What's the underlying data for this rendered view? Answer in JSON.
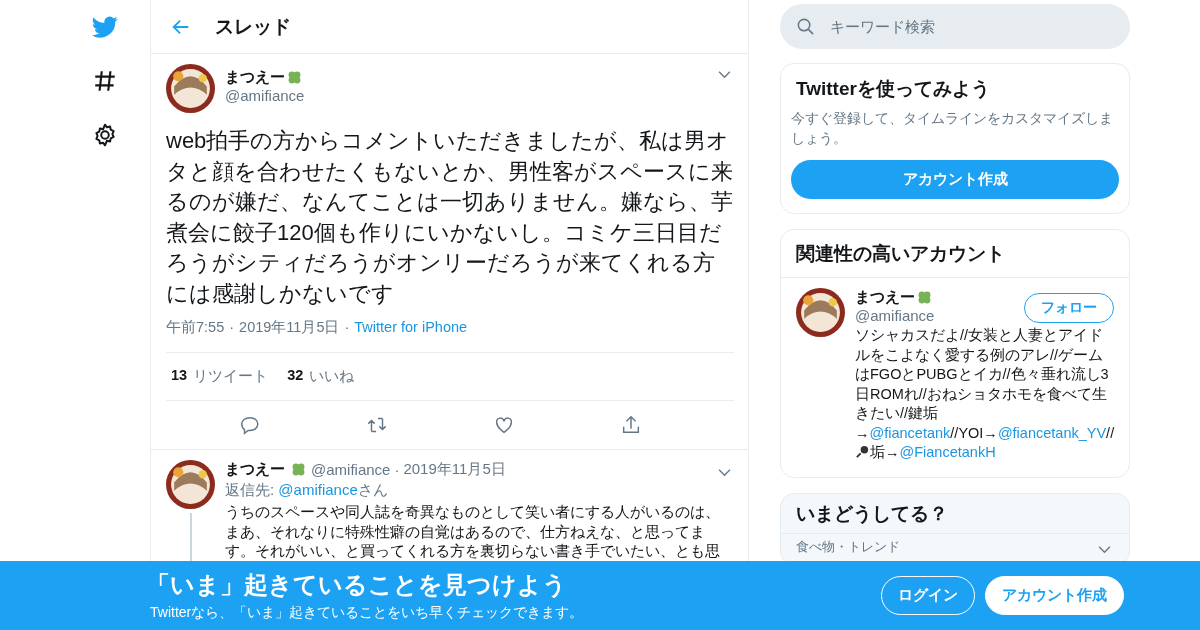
{
  "header": {
    "title": "スレッド"
  },
  "tweet": {
    "name": "まつえー",
    "handle": "@amifiance",
    "text": "web拍手の方からコメントいただきましたが、私は男オタと顔を合わせたくもないとか、男性客がスペースに来るのが嫌だ、なんてことは一切ありません。嫌なら、芋煮会に餃子120個も作りにいかないし。コミケ三日目だろうがシティだろうがオンリーだろうが来てくれる方には感謝しかないです",
    "time": "午前7:55",
    "separator": "·",
    "date": "2019年11月5日",
    "source": "Twitter for iPhone",
    "retweets": "13",
    "retweets_label": "リツイート",
    "likes": "32",
    "likes_label": "いいね"
  },
  "reply": {
    "name": "まつえー",
    "handle": "@amifiance",
    "separator": "·",
    "date": "2019年11月5日",
    "reply_prefix": "返信先: ",
    "reply_to": "@amifiance",
    "reply_suffix": "さん",
    "text": "うちのスペースや同人誌を奇異なものとして笑い者にする人がいるのは、まあ、それなりに特殊性癖の自覚はあるので、仕方ねえな、と思ってます。それがいい、と買ってくれる方を裏切らない書き手でいたい、とも思"
  },
  "search": {
    "placeholder": "キーワード検索"
  },
  "signup_card": {
    "title": "Twitterを使ってみよう",
    "text": "今すぐ登録して、タイムラインをカスタマイズしましょう。",
    "button": "アカウント作成"
  },
  "related": {
    "title": "関連性の高いアカウント",
    "name": "まつえー",
    "handle": "@amifiance",
    "follow": "フォロー",
    "bio": [
      {
        "kind": "text",
        "text": "ソシャカスだよ//女装と人妻とアイドルをこよなく愛する例のアレ//ゲームはFGOとPUBGとイカ//色々垂れ流し3日ROMれ//おねショタホモを食べて生きたい//鍵垢→"
      },
      {
        "kind": "link",
        "text": "@fiancetank"
      },
      {
        "kind": "text",
        "text": "//YOI→"
      },
      {
        "kind": "link",
        "text": "@fiancetank_YV"
      },
      {
        "kind": "text",
        "text": "//"
      },
      {
        "kind": "mic"
      },
      {
        "kind": "text",
        "text": "垢→"
      },
      {
        "kind": "link",
        "text": "@FiancetankH"
      }
    ]
  },
  "trends": {
    "title": "いまどうしてる？",
    "item": "食べ物・トレンド"
  },
  "banner": {
    "title": "「いま」起きていることを見つけよう",
    "subtitle": "Twitterなら、「いま」起きていることをいち早くチェックできます。",
    "login": "ログイン",
    "signup": "アカウント作成"
  }
}
